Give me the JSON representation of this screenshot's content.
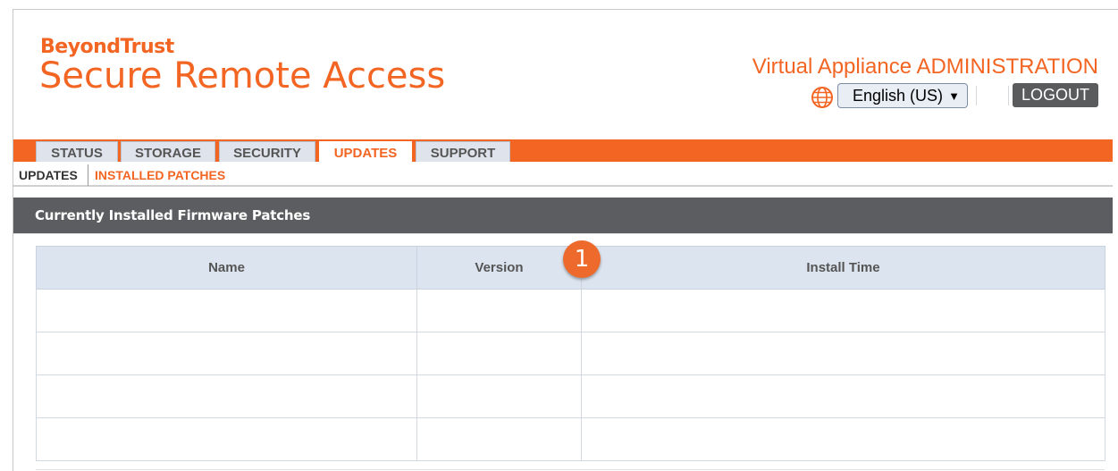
{
  "brand": {
    "company": "BeyondTrust",
    "product": "Secure Remote Access"
  },
  "header": {
    "title": "Virtual Appliance ADMINISTRATION",
    "language_selected": "English (US)",
    "logout_label": "LOGOUT",
    "globe_icon": "globe-icon"
  },
  "tabs": [
    {
      "label": "STATUS",
      "active": false
    },
    {
      "label": "STORAGE",
      "active": false
    },
    {
      "label": "SECURITY",
      "active": false
    },
    {
      "label": "UPDATES",
      "active": true
    },
    {
      "label": "SUPPORT",
      "active": false
    }
  ],
  "subnav": [
    {
      "label": "UPDATES",
      "active": false
    },
    {
      "label": "INSTALLED PATCHES",
      "active": true
    }
  ],
  "panel": {
    "title": "Currently Installed Firmware Patches"
  },
  "table": {
    "columns": [
      "Name",
      "Version",
      "Install Time"
    ],
    "rows": [
      [
        "",
        "",
        ""
      ],
      [
        "",
        "",
        ""
      ],
      [
        "",
        "",
        ""
      ],
      [
        "",
        "",
        ""
      ]
    ]
  },
  "callout": {
    "number": "1"
  },
  "colors": {
    "accent": "#f26522",
    "header_bar": "#5c5d60",
    "tab_bg": "#dfe4ec",
    "table_head": "#dce4ef"
  }
}
